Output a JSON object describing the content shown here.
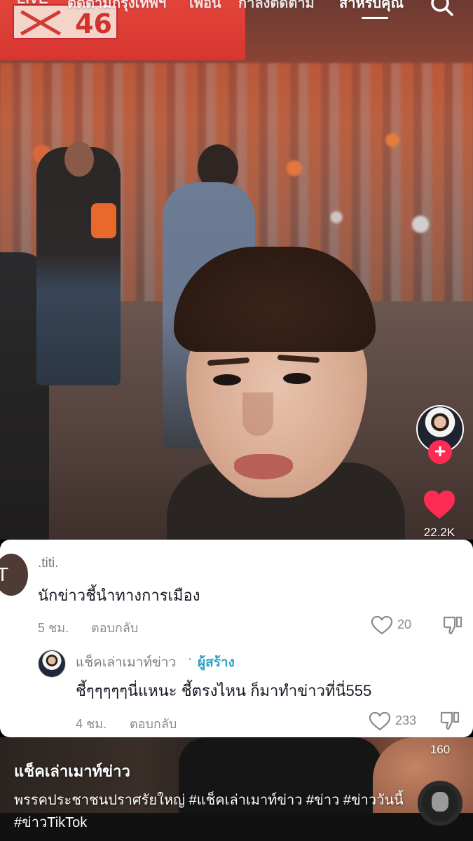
{
  "top_nav": {
    "tabs": [
      "LIVE",
      "ติดตาม",
      "กรุงเทพฯ",
      "เพื่อน",
      "กำลังติดตาม",
      "สำหรับคุณ"
    ],
    "active_tab": "สำหรับคุณ",
    "search_icon": "search-icon"
  },
  "stage": {
    "number": "46"
  },
  "actions": {
    "avatar_icon": "creator-avatar",
    "follow_icon": "plus-icon",
    "like_icon": "heart-icon",
    "like_count": "22.2K",
    "share_count": "160",
    "like_color": "#fe2c55"
  },
  "comments": [
    {
      "avatar_initial": "T",
      "username": ".titi.",
      "text": "นักข่าวชี้นำทางการเมือง",
      "time": "5 ชม.",
      "reply_label": "ตอบกลับ",
      "like_count": "20"
    }
  ],
  "reply": {
    "username": "แช็คเล่าเมาท์ข่าว",
    "separator": "·",
    "creator_badge": "ผู้สร้าง",
    "text": "ชี้ๆๆๆๆๆนี่แหนะ ชี้ตรงไหน ก็มาทำข่าวที่นี่555",
    "time": "4 ชม.",
    "reply_label": "ตอบกลับ",
    "like_count": "233",
    "creator_color": "#2aa3c8"
  },
  "caption": {
    "username": "แช็คเล่าเมาท์ข่าว",
    "text": "พรรคประชาชนปราศรัยใหญ่ #แช็คเล่าเมาท์ข่าว #ข่าว #ข่าววันนี้ #ข่าวTikTok"
  }
}
